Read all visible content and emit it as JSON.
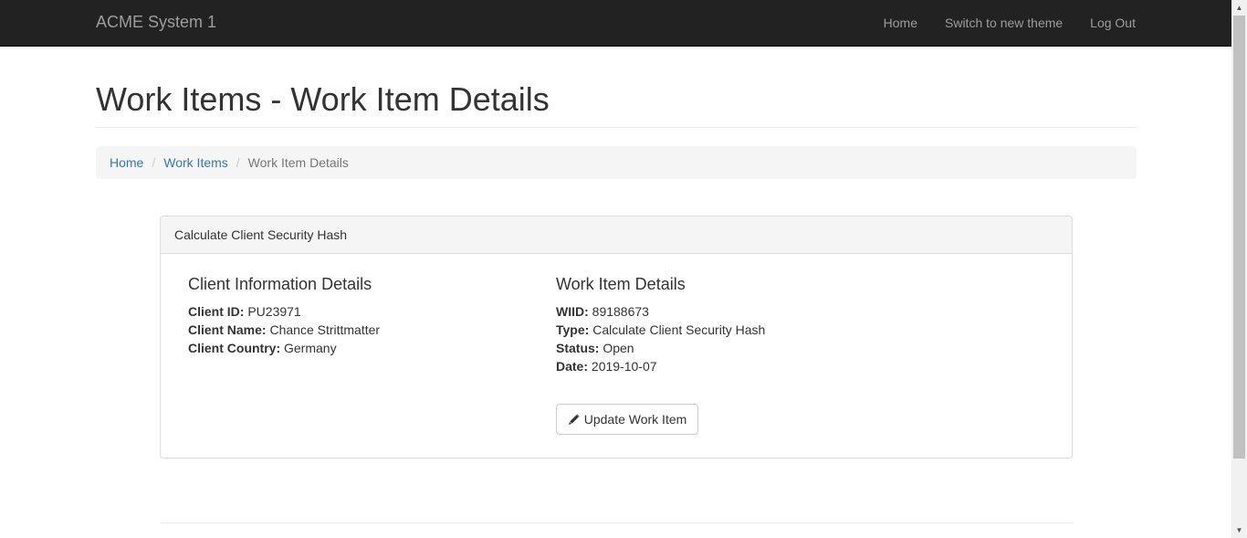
{
  "navbar": {
    "brand": "ACME System 1",
    "links": [
      "Home",
      "Switch to new theme",
      "Log Out"
    ]
  },
  "page": {
    "title": "Work Items - Work Item Details"
  },
  "breadcrumb": {
    "home": "Home",
    "work_items": "Work Items",
    "current": "Work Item Details",
    "separator": "/"
  },
  "panel": {
    "heading": "Calculate Client Security Hash",
    "client": {
      "title": "Client Information Details",
      "id_label": "Client ID:",
      "id_value": "PU23971",
      "name_label": "Client Name:",
      "name_value": "Chance Strittmatter",
      "country_label": "Client Country:",
      "country_value": "Germany"
    },
    "work_item": {
      "title": "Work Item Details",
      "wiid_label": "WIID:",
      "wiid_value": "89188673",
      "type_label": "Type:",
      "type_value": "Calculate Client Security Hash",
      "status_label": "Status:",
      "status_value": "Open",
      "date_label": "Date:",
      "date_value": "2019-10-07"
    },
    "update_button": {
      "label": "Update Work Item",
      "icon": "pencil-icon"
    }
  },
  "colors": {
    "navbar_bg": "#222222",
    "nav_text": "#9d9d9d",
    "link": "#337ab7"
  }
}
